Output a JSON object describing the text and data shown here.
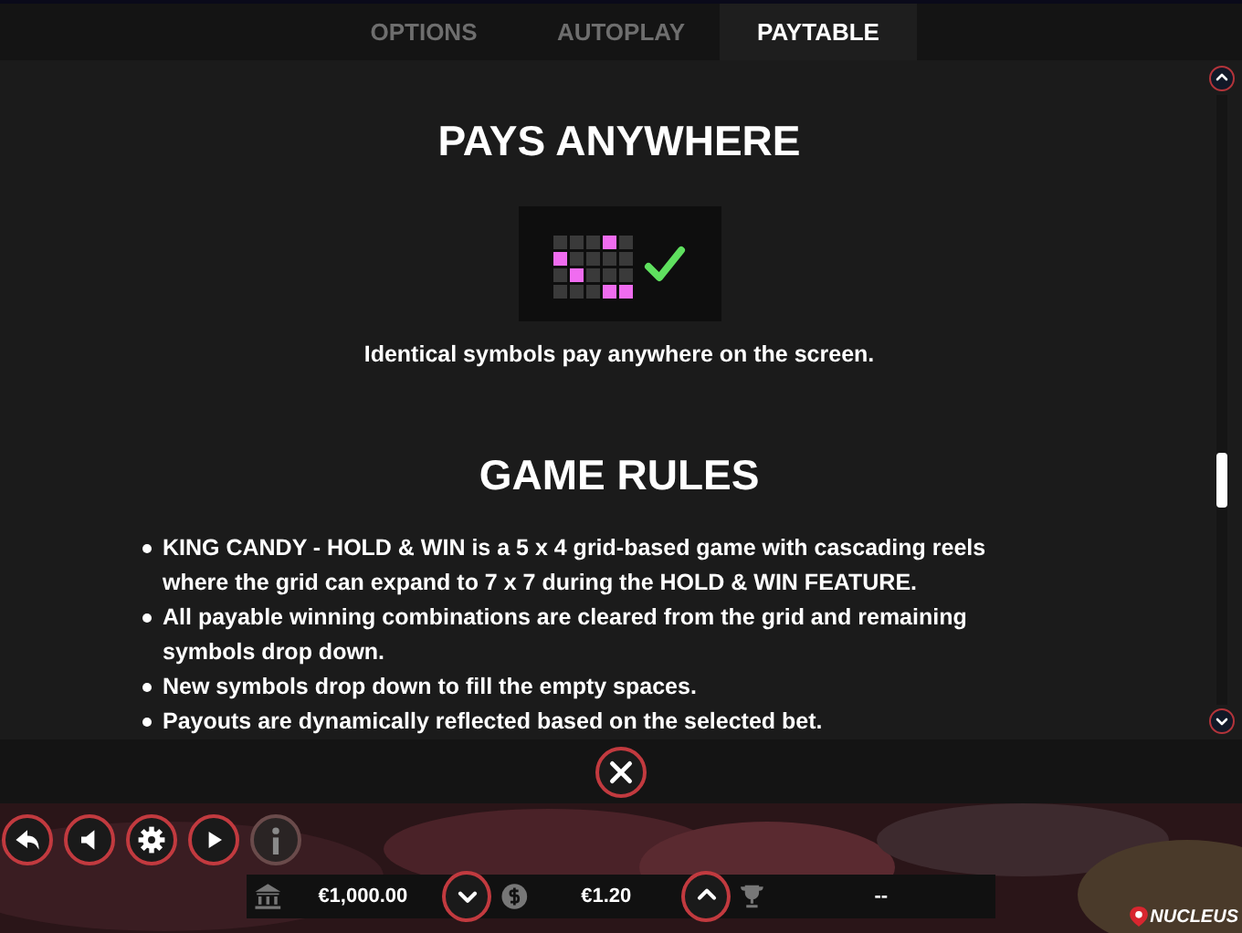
{
  "tabs": [
    {
      "label": "OPTIONS",
      "selected": false
    },
    {
      "label": "AUTOPLAY",
      "selected": false
    },
    {
      "label": "PAYTABLE",
      "selected": true
    }
  ],
  "pays_section": {
    "title": "PAYS ANYWHERE",
    "description": "Identical symbols pay anywhere on the screen."
  },
  "rules_section": {
    "title": "GAME RULES",
    "rules": [
      "KING CANDY - HOLD & WIN is a 5 x 4 grid-based game with cascading reels where the grid can expand to 7 x 7 during the HOLD & WIN FEATURE.",
      "All payable winning combinations are cleared from the grid and remaining symbols drop down.",
      "New symbols drop down to fill the empty spaces.",
      "Payouts are dynamically reflected based on the selected bet."
    ]
  },
  "controls": [
    {
      "kind": "back",
      "disabled": false
    },
    {
      "kind": "sound",
      "disabled": false
    },
    {
      "kind": "settings",
      "disabled": false
    },
    {
      "kind": "autoplay",
      "disabled": false
    },
    {
      "kind": "info",
      "disabled": true
    }
  ],
  "status_bar": {
    "balance": "€1,000.00",
    "bet": "€1.20",
    "win": "--"
  },
  "logo": {
    "text": "NUCLEUS"
  }
}
